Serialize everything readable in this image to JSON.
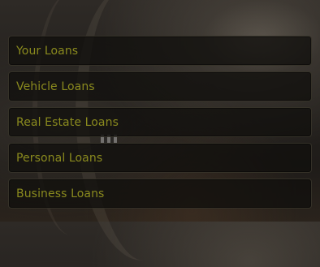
{
  "menu": {
    "items": [
      {
        "label": "Your Loans"
      },
      {
        "label": "Vehicle Loans"
      },
      {
        "label": "Real Estate Loans"
      },
      {
        "label": "Personal Loans"
      },
      {
        "label": "Business Loans"
      }
    ]
  },
  "colors": {
    "label_text": "#8a8a1e",
    "button_bg": "#11100d",
    "button_border": "#504a3c"
  }
}
